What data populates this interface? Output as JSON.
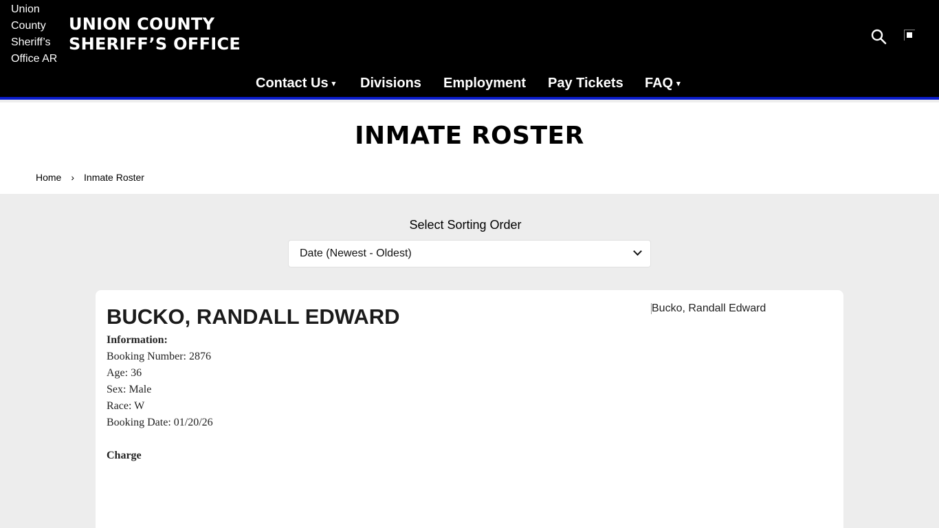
{
  "header": {
    "logo_alt": "Union County Sheriff’s Office AR",
    "brand_line1": "UNION COUNTY",
    "brand_line2": "SHERIFF’S OFFICE"
  },
  "nav": {
    "items": [
      {
        "label": "Contact Us",
        "has_dropdown": true
      },
      {
        "label": "Divisions",
        "has_dropdown": false
      },
      {
        "label": "Employment",
        "has_dropdown": false
      },
      {
        "label": "Pay Tickets",
        "has_dropdown": false
      },
      {
        "label": "FAQ",
        "has_dropdown": true
      }
    ],
    "caret": "▾"
  },
  "page": {
    "title": "INMATE ROSTER",
    "breadcrumb": {
      "home": "Home",
      "separator": "›",
      "current": "Inmate Roster"
    }
  },
  "sorting": {
    "label": "Select Sorting Order",
    "selected": "Date (Newest - Oldest)"
  },
  "inmate": {
    "name": "BUCKO, RANDALL EDWARD",
    "photo_alt": "Bucko, Randall Edward",
    "info_heading": "Information:",
    "booking_number": "Booking Number: 2876",
    "age": "Age: 36",
    "sex": "Sex: Male",
    "race": "Race: W",
    "booking_date": "Booking Date: 01/20/26",
    "charge_heading": "Charge"
  },
  "colors": {
    "header_bg": "#000000",
    "header_accent": "#0a1ccc",
    "page_bg": "#ededed",
    "card_bg": "#ffffff"
  },
  "icons": {
    "search": "search-icon",
    "broken_image": "broken-image-icon"
  }
}
